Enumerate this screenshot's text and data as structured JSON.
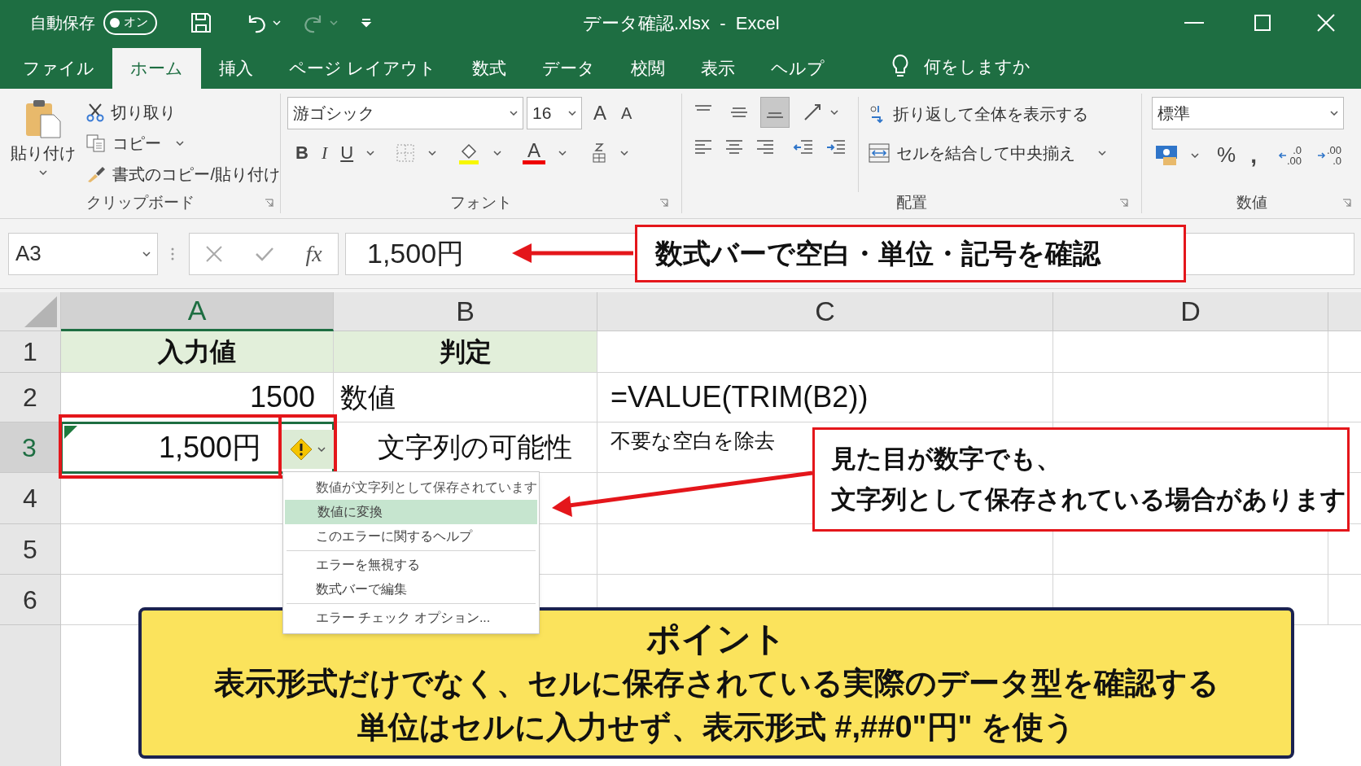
{
  "title_bar": {
    "autosave_label": "自動保存",
    "autosave_toggle": {
      "label": "オン",
      "on": true
    },
    "title": "データ確認.xlsx  -  Excel"
  },
  "tabs": [
    {
      "label": "ファイル",
      "selected": false
    },
    {
      "label": "ホーム",
      "selected": true
    },
    {
      "label": "挿入",
      "selected": false
    },
    {
      "label": "ページ レイアウト",
      "selected": false
    },
    {
      "label": "数式",
      "selected": false
    },
    {
      "label": "データ",
      "selected": false
    },
    {
      "label": "校閲",
      "selected": false
    },
    {
      "label": "表示",
      "selected": false
    },
    {
      "label": "ヘルプ",
      "selected": false
    }
  ],
  "tell_me": "何をしますか",
  "ribbon": {
    "clipboard": {
      "label": "クリップボード",
      "paste": "貼り付け",
      "cut": "切り取り",
      "copy": "コピー",
      "format_painter": "書式のコピー/貼り付け"
    },
    "font": {
      "label": "フォント",
      "font_name": "游ゴシック",
      "font_size": "16",
      "grow": "A",
      "shrink": "A",
      "bold": "B",
      "italic": "I",
      "underline": "U",
      "font_color": "A"
    },
    "alignment": {
      "label": "配置",
      "vertical": [
        {
          "kind": "top",
          "selected": false
        },
        {
          "kind": "middle",
          "selected": false
        },
        {
          "kind": "bottom",
          "selected": true
        }
      ],
      "wrap": "折り返して全体を表示する",
      "merge": "セルを結合して中央揃え"
    },
    "number": {
      "label": "数値",
      "format": "標準",
      "percent": "%",
      "comma": ",",
      "increase_decimal": [
        ".0",
        ".00"
      ],
      "decrease_decimal": [
        ".00",
        ".0"
      ]
    }
  },
  "formula_bar": {
    "name_box": "A3",
    "fx": "fx",
    "formula": "1,500円"
  },
  "columns": [
    {
      "label": "A",
      "selected": true
    },
    {
      "label": "B",
      "selected": false
    },
    {
      "label": "C",
      "selected": false
    },
    {
      "label": "D",
      "selected": false
    }
  ],
  "rows": [
    {
      "label": "1",
      "selected": false,
      "cells": [
        {
          "kind": "header",
          "text": "入力値"
        },
        {
          "kind": "header",
          "text": "判定"
        },
        {
          "kind": "empty"
        },
        {
          "kind": "empty"
        }
      ]
    },
    {
      "label": "2",
      "selected": false,
      "cells": [
        {
          "kind": "number",
          "text": "1500"
        },
        {
          "kind": "text",
          "text": "数値"
        },
        {
          "kind": "formula",
          "text": "=VALUE(TRIM(B2))"
        },
        {
          "kind": "empty"
        }
      ]
    },
    {
      "label": "3",
      "selected": true,
      "cells": [
        {
          "kind": "number",
          "text": "1,500円",
          "error_flag": true,
          "selected": true
        },
        {
          "kind": "center",
          "text": "文字列の可能性"
        },
        {
          "kind": "note",
          "text": "不要な空白を除去"
        },
        {
          "kind": "empty"
        }
      ]
    },
    {
      "label": "4",
      "selected": false,
      "cells": [
        {
          "kind": "empty"
        },
        {
          "kind": "empty"
        },
        {
          "kind": "empty"
        },
        {
          "kind": "empty"
        }
      ]
    },
    {
      "label": "5",
      "selected": false,
      "cells": [
        {
          "kind": "empty"
        },
        {
          "kind": "empty"
        },
        {
          "kind": "empty"
        },
        {
          "kind": "empty"
        }
      ]
    },
    {
      "label": "6",
      "selected": false,
      "cells": [
        {
          "kind": "empty"
        },
        {
          "kind": "empty"
        },
        {
          "kind": "empty"
        },
        {
          "kind": "empty"
        }
      ]
    }
  ],
  "error_menu": [
    {
      "kind": "header",
      "label": "数値が文字列として保存されています",
      "selected": false
    },
    {
      "kind": "item",
      "label": "数値に変換",
      "selected": true
    },
    {
      "kind": "item",
      "label": "このエラーに関するヘルプ",
      "selected": false
    },
    {
      "kind": "separator_item",
      "label": "エラーを無視する",
      "selected": false
    },
    {
      "kind": "item",
      "label": "数式バーで編集",
      "selected": false
    },
    {
      "kind": "separator_item",
      "label": "エラー チェック オプション...",
      "selected": false
    }
  ],
  "annotations": {
    "formula_note": "数式バーで空白・単位・記号を確認",
    "callout": [
      "見た目が数字でも、",
      "文字列として保存されている場合があります"
    ],
    "point": {
      "title": "ポイント",
      "lines": [
        "表示形式だけでなく、セルに保存されている実際のデータ型を確認する",
        "単位はセルに入力せず、表示形式 #,##0\"円\" を使う"
      ]
    }
  }
}
